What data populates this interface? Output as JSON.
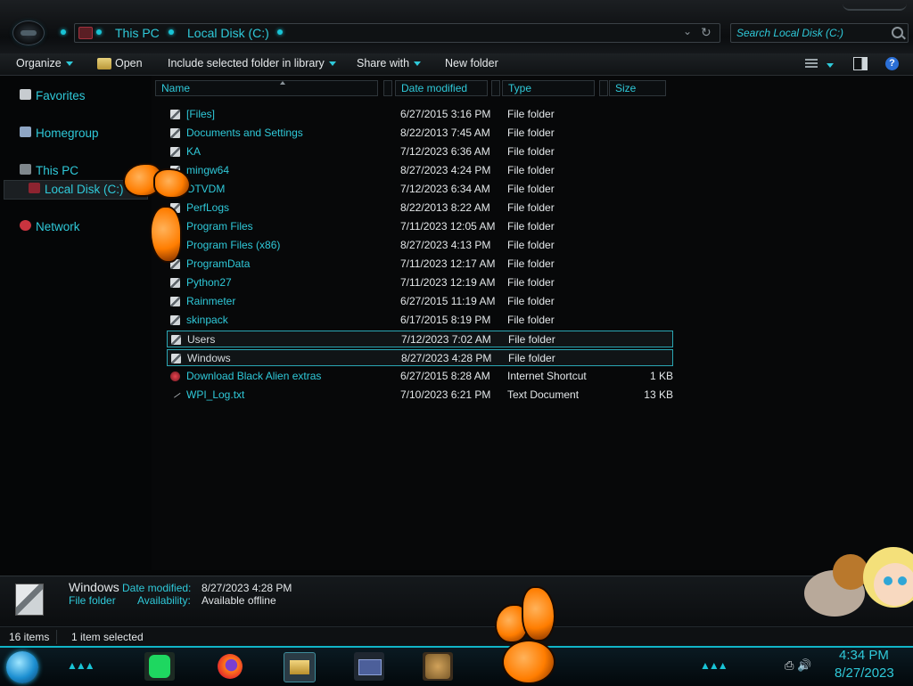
{
  "window": {
    "breadcrumb": [
      "This PC",
      "Local Disk (C:)"
    ],
    "search_placeholder": "Search Local Disk (C:)"
  },
  "toolbar": {
    "organize": "Organize",
    "open": "Open",
    "include": "Include selected folder in library",
    "share": "Share with",
    "new_folder": "New folder"
  },
  "nav": {
    "favorites": "Favorites",
    "homegroup": "Homegroup",
    "this_pc": "This PC",
    "local_disk": "Local Disk (C:)",
    "network": "Network"
  },
  "columns": {
    "name": "Name",
    "date": "Date modified",
    "type": "Type",
    "size": "Size"
  },
  "files": [
    {
      "name": "[Files]",
      "date": "6/27/2015 3:16 PM",
      "type": "File folder",
      "size": "",
      "icon": "folder-icon"
    },
    {
      "name": "Documents and Settings",
      "date": "8/22/2013 7:45 AM",
      "type": "File folder",
      "size": "",
      "icon": "folder-icon"
    },
    {
      "name": "KA",
      "date": "7/12/2023 6:36 AM",
      "type": "File folder",
      "size": "",
      "icon": "folder-icon"
    },
    {
      "name": "mingw64",
      "date": "8/27/2023 4:24 PM",
      "type": "File folder",
      "size": "",
      "icon": "folder-icon"
    },
    {
      "name": "OTVDM",
      "date": "7/12/2023 6:34 AM",
      "type": "File folder",
      "size": "",
      "icon": "folder-icon"
    },
    {
      "name": "PerfLogs",
      "date": "8/22/2013 8:22 AM",
      "type": "File folder",
      "size": "",
      "icon": "folder-icon"
    },
    {
      "name": "Program Files",
      "date": "7/11/2023 12:05 AM",
      "type": "File folder",
      "size": "",
      "icon": "folder-icon"
    },
    {
      "name": "Program Files (x86)",
      "date": "8/27/2023 4:13 PM",
      "type": "File folder",
      "size": "",
      "icon": "folder-icon"
    },
    {
      "name": "ProgramData",
      "date": "7/11/2023 12:17 AM",
      "type": "File folder",
      "size": "",
      "icon": "folder-icon"
    },
    {
      "name": "Python27",
      "date": "7/11/2023 12:19 AM",
      "type": "File folder",
      "size": "",
      "icon": "folder-icon"
    },
    {
      "name": "Rainmeter",
      "date": "6/27/2015 11:19 AM",
      "type": "File folder",
      "size": "",
      "icon": "folder-icon"
    },
    {
      "name": "skinpack",
      "date": "6/17/2015 8:19 PM",
      "type": "File folder",
      "size": "",
      "icon": "folder-icon"
    },
    {
      "name": "Users",
      "date": "7/12/2023 7:02 AM",
      "type": "File folder",
      "size": "",
      "icon": "folder-icon"
    },
    {
      "name": "Windows",
      "date": "8/27/2023 4:28 PM",
      "type": "File folder",
      "size": "",
      "icon": "folder-icon"
    },
    {
      "name": "Download Black Alien extras",
      "date": "6/27/2015 8:28 AM",
      "type": "Internet Shortcut",
      "size": "1 KB",
      "icon": "shortcut-icon"
    },
    {
      "name": "WPI_Log.txt",
      "date": "7/10/2023 6:21 PM",
      "type": "Text Document",
      "size": "13 KB",
      "icon": "text-file-icon"
    }
  ],
  "details": {
    "name": "Windows",
    "date_label": "Date modified:",
    "date_value": "8/27/2023 4:28 PM",
    "type_value": "File folder",
    "avail_label": "Availability:",
    "avail_value": "Available offline"
  },
  "status": {
    "items": "16 items",
    "selected": "1 item selected"
  },
  "clock": {
    "time": "4:34 PM",
    "date": "8/27/2023"
  },
  "colors": {
    "accent": "#2fc9d9",
    "background": "#050607"
  }
}
